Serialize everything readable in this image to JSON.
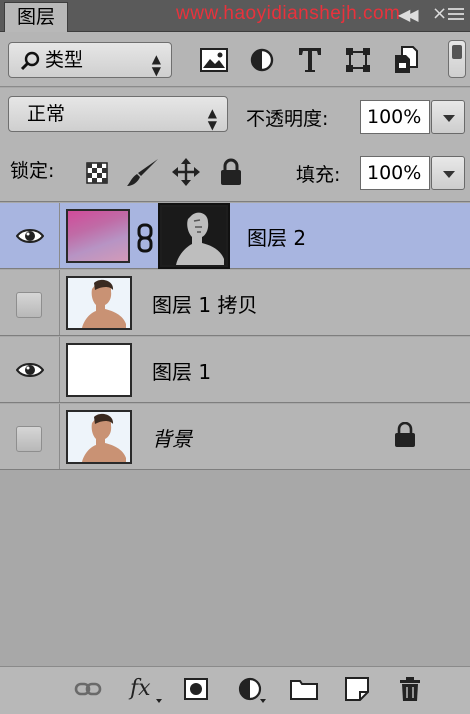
{
  "panel": {
    "tab_label": "图层",
    "watermark": "www.haoyidianshejh.com",
    "collapse_glyph": "◀◀",
    "close_glyph": "×"
  },
  "filter": {
    "kind_label": "类型",
    "filter_icons": [
      "image-filter-icon",
      "adjustment-filter-icon",
      "type-filter-icon",
      "shape-filter-icon",
      "smart-object-filter-icon"
    ]
  },
  "blend": {
    "mode": "正常",
    "opacity_label": "不透明度:",
    "opacity_value": "100%"
  },
  "lock": {
    "label": "锁定:",
    "fill_label": "填充:",
    "fill_value": "100%"
  },
  "layers": [
    {
      "name": "图层 2",
      "visible": true,
      "selected": true,
      "has_mask": true
    },
    {
      "name": "图层 1 拷贝",
      "visible": false,
      "selected": false
    },
    {
      "name": "图层 1",
      "visible": true,
      "selected": false
    },
    {
      "name": "背景",
      "visible": false,
      "selected": false,
      "locked": true
    }
  ],
  "colors": {
    "selected_row": "#a8b5e0",
    "panel_bg": "#b5b5b5",
    "watermark": "#e8323c"
  }
}
